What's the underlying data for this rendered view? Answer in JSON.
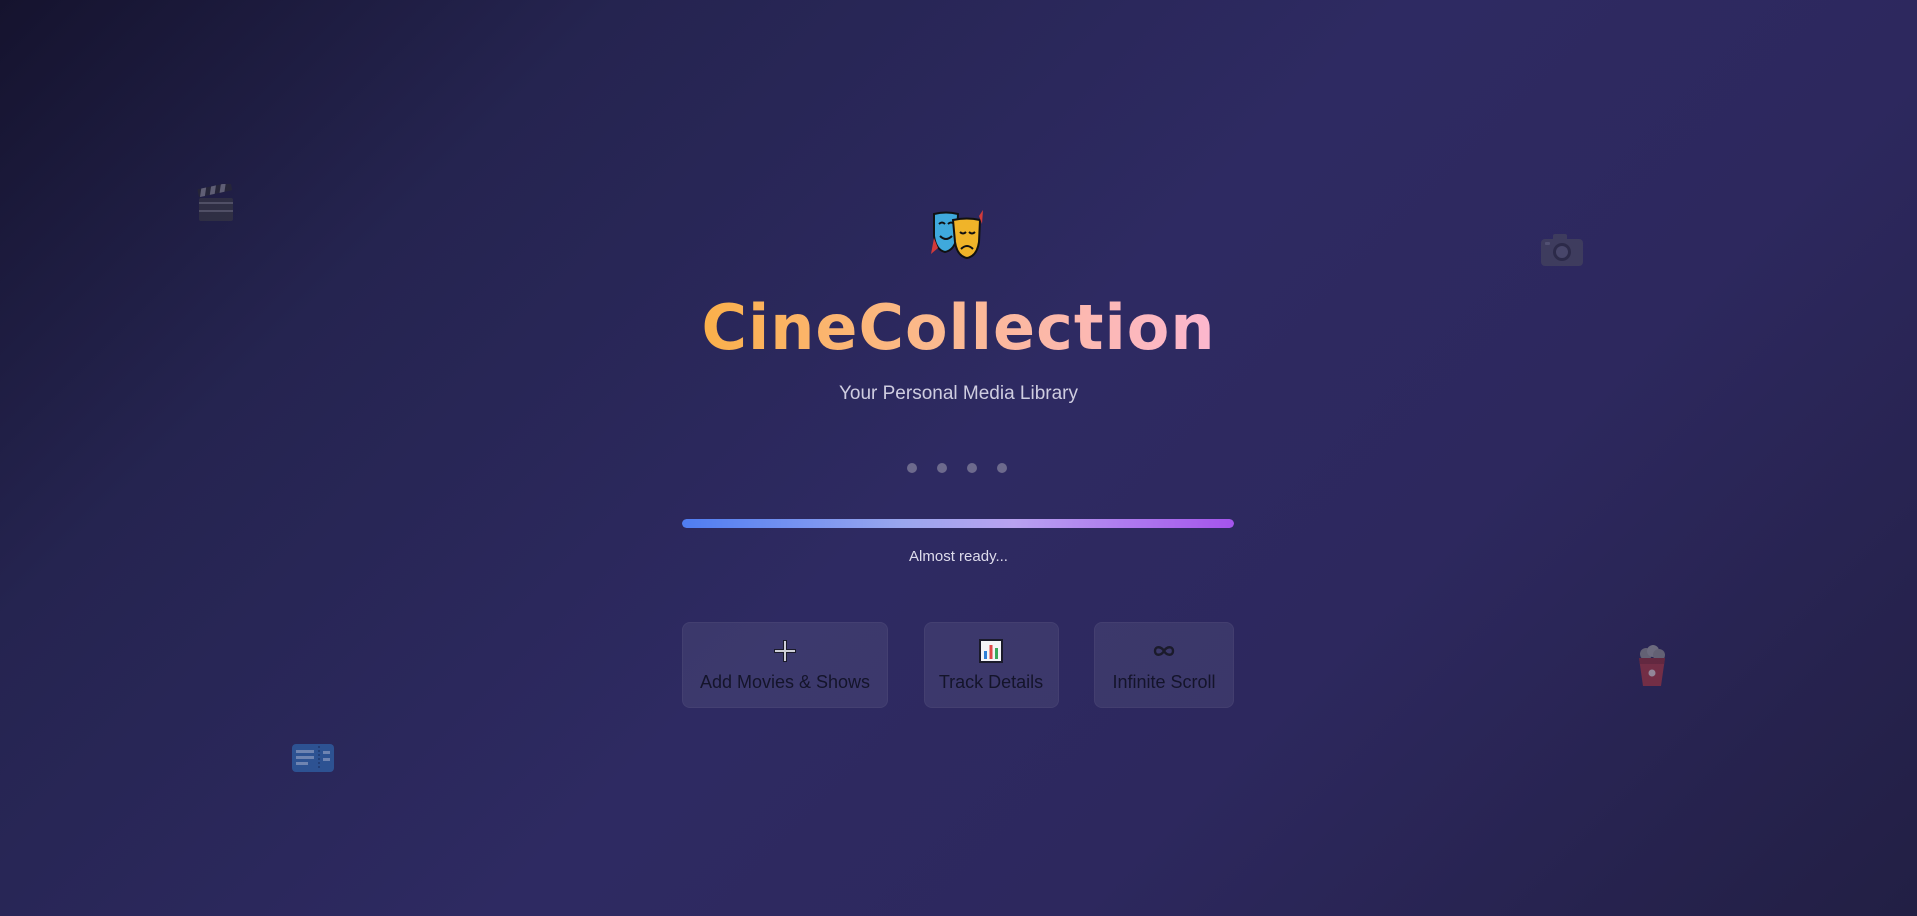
{
  "app": {
    "title": "CineCollection",
    "subtitle": "Your Personal Media Library",
    "logo_icon": "theater-masks-icon"
  },
  "loading": {
    "dots_count": 4,
    "progress": 1.0,
    "status_text": "Almost ready..."
  },
  "features": [
    {
      "icon": "plus-icon",
      "label": "Add Movies & Shows"
    },
    {
      "icon": "bar-chart-icon",
      "label": "Track Details"
    },
    {
      "icon": "infinity-icon",
      "label": "Infinite Scroll"
    }
  ],
  "background_icons": [
    "clapperboard-icon",
    "camera-icon",
    "popcorn-icon",
    "ticket-icon"
  ],
  "colors": {
    "title_gradient_start": "#fbb04a",
    "title_gradient_end": "#fcb7cf",
    "progress_start": "#4f7df2",
    "progress_end": "#a454ec",
    "background": "#2e2a62"
  }
}
